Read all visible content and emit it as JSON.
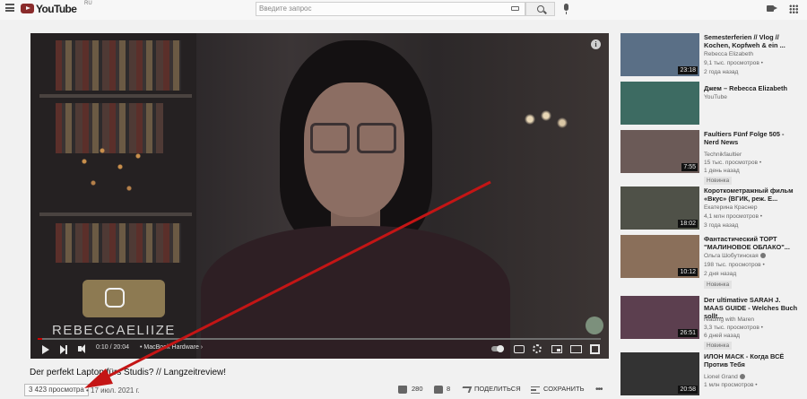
{
  "header": {
    "logo_text": "YouTube",
    "logo_region": "RU",
    "search_placeholder": "Введите запрос"
  },
  "player": {
    "watermark": "REBECCAELIIZE",
    "info_label": "i",
    "time": "0:10 / 20:04",
    "chapter": "• MacBook Hardware ›",
    "progress_fraction": 0.008
  },
  "video": {
    "title": "Der perfekt Laptop fürs Studis? // Langzeitreview!",
    "views": "3 423 просмотра",
    "date": "• 17 июл. 2021 г.",
    "likes": "280",
    "dislikes": "8",
    "share_label": "ПОДЕЛИТЬСЯ",
    "save_label": "СОХРАНИТЬ",
    "more_label": "•••"
  },
  "recommendations": [
    {
      "title": "Semesterferien // Vlog // Kochen, Kopfweh & ein ...",
      "channel": "Rebecca Elizabeth",
      "views": "9,1 тыс. просмотров •",
      "age": "2 года назад",
      "duration": "23:18",
      "badge": "",
      "verified": false,
      "thumb_color": "#5a6f86"
    },
    {
      "title": "Джем – Rebecca Elizabeth",
      "channel": "YouTube",
      "views": "",
      "age": "",
      "duration": "",
      "badge": "",
      "verified": false,
      "thumb_color": "#3d6b62"
    },
    {
      "title": "Faultiers Fünf Folge 505 - Nerd News",
      "channel": "Technikfaultier",
      "views": "15 тыс. просмотров •",
      "age": "1 день назад",
      "duration": "7:55",
      "badge": "Новинка",
      "verified": false,
      "thumb_color": "#6b5a57"
    },
    {
      "title": "Короткометражный фильм «Вкус» (ВГИК, реж. Е...",
      "channel": "Екатерина Краснер",
      "views": "4,1 млн просмотров •",
      "age": "3 года назад",
      "duration": "18:02",
      "badge": "",
      "verified": false,
      "thumb_color": "#4f5148"
    },
    {
      "title": "Фантастический ТОРТ \"МАЛИНОВОЕ ОБЛАКО\"...",
      "channel": "Ольга Шобутинская",
      "views": "198 тыс. просмотров •",
      "age": "2 дня назад",
      "duration": "10:12",
      "badge": "Новинка",
      "verified": true,
      "thumb_color": "#8a6f5a"
    },
    {
      "title": "Der ultimative SARAH J. MAAS GUIDE - Welches Buch sollt...",
      "channel": "reading with Maren",
      "views": "3,3 тыс. просмотров •",
      "age": "6 дней назад",
      "duration": "26:51",
      "badge": "Новинка",
      "verified": false,
      "thumb_color": "#5c3f4f"
    },
    {
      "title": "ИЛОН МАСК - Когда ВСЁ Против Тебя",
      "channel": "Lionel Grand",
      "views": "1 млн просмотров •",
      "age": "",
      "duration": "20:58",
      "badge": "",
      "verified": true,
      "thumb_color": "#333333"
    }
  ],
  "colors": {
    "arrow": "#c41515",
    "page_bg": "#f1f1f1"
  }
}
